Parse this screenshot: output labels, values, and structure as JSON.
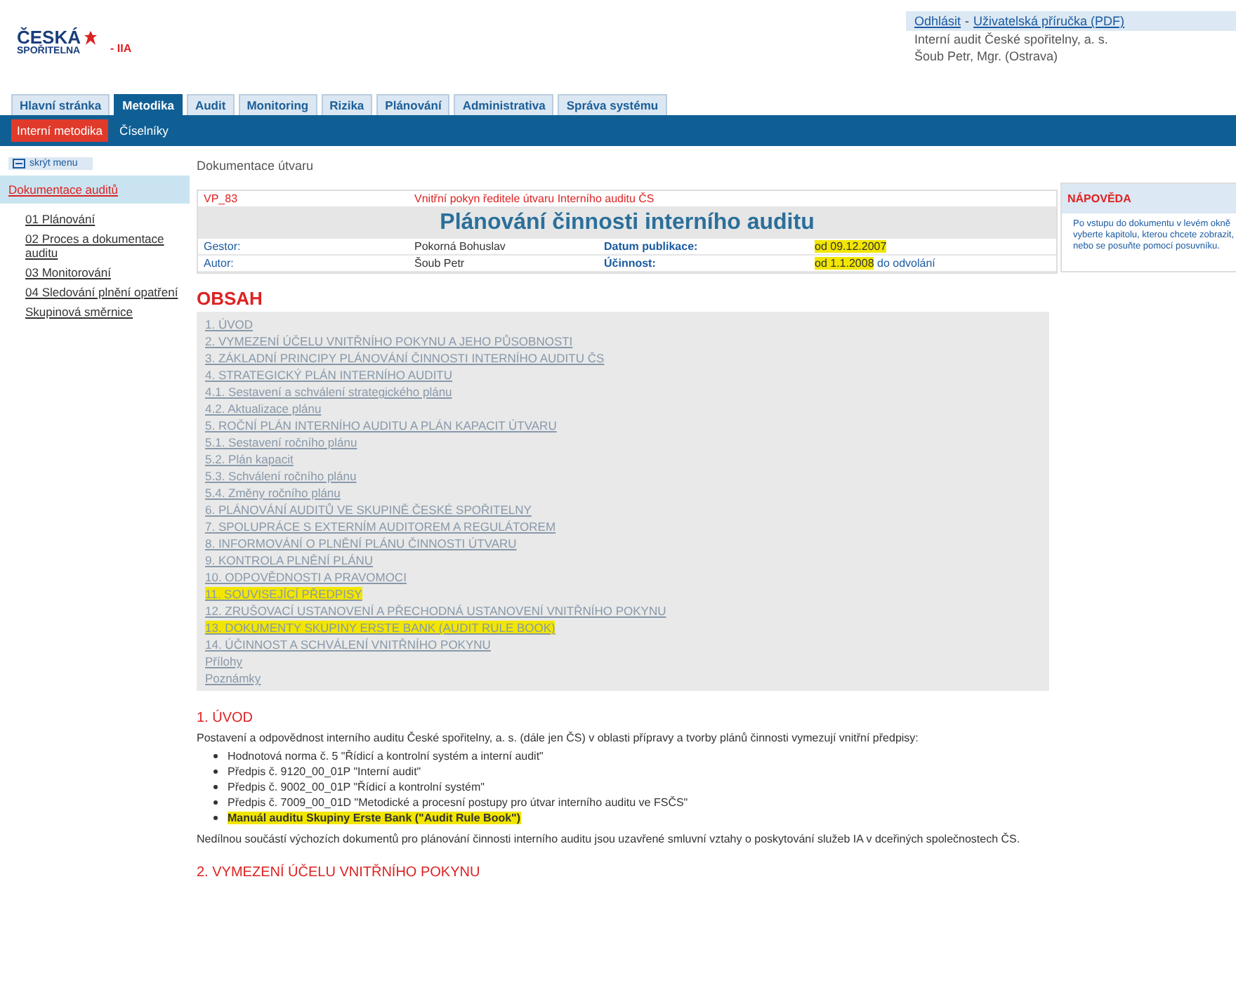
{
  "logo": {
    "line1": "ČESKÁ",
    "line2": "SPOŘITELNA",
    "suffix": "- IIA"
  },
  "user_box": {
    "links": [
      "Odhlásit",
      "Uživatelská příručka (PDF)"
    ],
    "separator": "-",
    "org": "Interní audit České spořitelny, a. s.",
    "user": "Šoub Petr, Mgr. (Ostrava)"
  },
  "tabs": [
    {
      "label": "Hlavní stránka",
      "selected": false
    },
    {
      "label": "Metodika",
      "selected": true
    },
    {
      "label": "Audit",
      "selected": false
    },
    {
      "label": "Monitoring",
      "selected": false
    },
    {
      "label": "Rizika",
      "selected": false
    },
    {
      "label": "Plánování",
      "selected": false
    },
    {
      "label": "Administrativa",
      "selected": false
    },
    {
      "label": "Správa systému",
      "selected": false
    }
  ],
  "subtabs": [
    {
      "label": "Interní metodika",
      "selected": true
    },
    {
      "label": "Číselníky",
      "selected": false
    }
  ],
  "sidebar": {
    "hide_button": "skrýt menu",
    "items": [
      {
        "label": "Dokumentace auditů",
        "selected": true
      },
      {
        "label": "01 Plánování",
        "selected": false
      },
      {
        "label": "02 Proces a dokumentace auditu",
        "selected": false
      },
      {
        "label": "03 Monitorování",
        "selected": false
      },
      {
        "label": "04 Sledování plnění opatření",
        "selected": false
      },
      {
        "label": "Skupinová směrnice",
        "selected": false
      }
    ]
  },
  "breadcrumb": "Dokumentace útvaru",
  "document": {
    "code": "VP_83",
    "type": "Vnitřní pokyn ředitele útvaru Interního auditu ČS",
    "title": "Plánování činnosti interního auditu",
    "rows": [
      {
        "label": "Gestor:",
        "value": "Pokorná Bohuslav",
        "label2": "Datum publikace:",
        "value2": "od 09.12.2007",
        "note": ""
      },
      {
        "label": "Autor:",
        "value": "Šoub Petr",
        "label2": "Účinnost:",
        "value2": "od 1.1.2008",
        "note": "do odvolání"
      }
    ]
  },
  "help": {
    "title": "NÁPOVĚDA",
    "text": "Po vstupu do dokumentu v levém okně vyberte kapitolu, kterou chcete zobrazit, nebo se posuňte pomocí posuvníku."
  },
  "toc": {
    "title": "OBSAH",
    "items": [
      {
        "label": "1. ÚVOD",
        "highlighted": false
      },
      {
        "label": "2. VYMEZENÍ ÚČELU VNITŘNÍHO POKYNU A JEHO PŮSOBNOSTI",
        "highlighted": false
      },
      {
        "label": "3. ZÁKLADNÍ PRINCIPY PLÁNOVÁNÍ ČINNOSTI INTERNÍHO AUDITU ČS",
        "highlighted": false
      },
      {
        "label": "4. STRATEGICKÝ PLÁN INTERNÍHO AUDITU",
        "highlighted": false
      },
      {
        "label": "4.1. Sestavení a schválení strategického plánu",
        "highlighted": false
      },
      {
        "label": "4.2. Aktualizace plánu",
        "highlighted": false
      },
      {
        "label": "5. ROČNÍ PLÁN INTERNÍHO AUDITU A PLÁN KAPACIT ÚTVARU",
        "highlighted": false
      },
      {
        "label": "5.1. Sestavení ročního plánu",
        "highlighted": false
      },
      {
        "label": "5.2. Plán kapacit",
        "highlighted": false
      },
      {
        "label": "5.3. Schválení ročního plánu",
        "highlighted": false
      },
      {
        "label": "5.4. Změny ročního plánu",
        "highlighted": false
      },
      {
        "label": "6. PLÁNOVÁNÍ AUDITŮ VE SKUPINĚ ČESKÉ SPOŘITELNY",
        "highlighted": false
      },
      {
        "label": "7. SPOLUPRÁCE S EXTERNÍM AUDITOREM A REGULÁTOREM",
        "highlighted": false
      },
      {
        "label": "8. INFORMOVÁNÍ O PLNĚNÍ PLÁNU ČINNOSTI ÚTVARU",
        "highlighted": false
      },
      {
        "label": "9. KONTROLA PLNĚNÍ PLÁNU",
        "highlighted": false
      },
      {
        "label": "10. ODPOVĚDNOSTI A PRAVOMOCI",
        "highlighted": false
      },
      {
        "label": "11. SOUVISEJÍCÍ PŘEDPISY",
        "highlighted": true
      },
      {
        "label": "12. ZRUŠOVACÍ USTANOVENÍ A PŘECHODNÁ USTANOVENÍ VNITŘNÍHO POKYNU",
        "highlighted": false
      },
      {
        "label": "13. DOKUMENTY SKUPINY ERSTE BANK (AUDIT RULE BOOK)",
        "highlighted": true
      },
      {
        "label": "14. ÚČINNOST A SCHVÁLENÍ VNITŘNÍHO POKYNU",
        "highlighted": false
      },
      {
        "label": "Přílohy",
        "highlighted": false
      },
      {
        "label": "Poznámky",
        "highlighted": false
      }
    ]
  },
  "sections": [
    {
      "heading": "1. ÚVOD",
      "intro": "Postavení a odpovědnost interního auditu České spořitelny, a. s. (dále jen ČS) v oblasti přípravy a tvorby plánů činnosti vymezují vnitřní předpisy:",
      "bullets": [
        {
          "text": "Hodnotová norma č. 5 \"Řídicí a kontrolní systém a interní audit\"",
          "highlighted": false
        },
        {
          "text": "Předpis č. 9120_00_01P \"Interní audit\"",
          "highlighted": false
        },
        {
          "text": "Předpis č. 9002_00_01P \"Řídicí a kontrolní systém\"",
          "highlighted": false
        },
        {
          "text": "Předpis č. 7009_00_01D \"Metodické a procesní postupy pro útvar interního auditu ve FSČS\"",
          "highlighted": false
        },
        {
          "text": "Manuál auditu Skupiny Erste Bank (\"Audit Rule Book\")",
          "highlighted": true
        }
      ],
      "outro": "Nedílnou součástí výchozích dokumentů pro plánování činnosti interního auditu jsou uzavřené smluvní vztahy o poskytování služeb IA v dceřiných společnostech ČS."
    },
    {
      "heading": "2. VYMEZENÍ ÚČELU VNITŘNÍHO POKYNU"
    }
  ]
}
